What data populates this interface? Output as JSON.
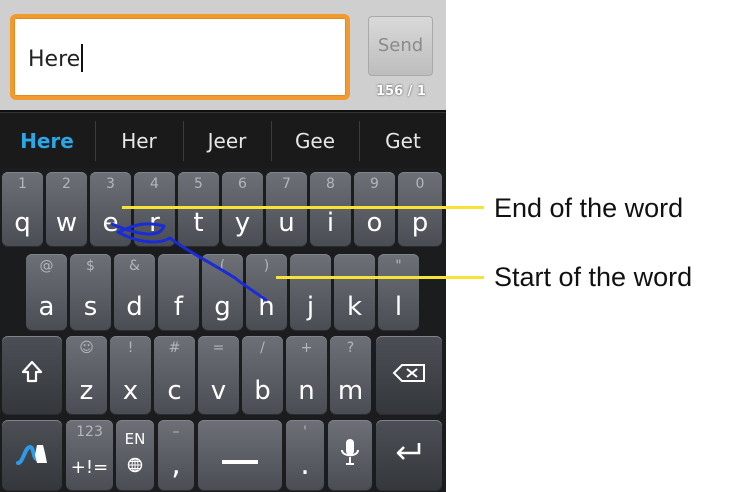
{
  "compose": {
    "message_value": "Here",
    "send_label": "Send",
    "counter": "156 / 1",
    "accent_color": "#f29a2e"
  },
  "suggestions": [
    "Here",
    "Her",
    "Jeer",
    "Gee",
    "Get"
  ],
  "suggestion_active_color": "#2ba6e6",
  "keyboard": {
    "row1": [
      {
        "hint": "1",
        "key": "q"
      },
      {
        "hint": "2",
        "key": "w"
      },
      {
        "hint": "3",
        "key": "e"
      },
      {
        "hint": "4",
        "key": "r"
      },
      {
        "hint": "5",
        "key": "t"
      },
      {
        "hint": "6",
        "key": "y"
      },
      {
        "hint": "7",
        "key": "u"
      },
      {
        "hint": "8",
        "key": "i"
      },
      {
        "hint": "9",
        "key": "o"
      },
      {
        "hint": "0",
        "key": "p"
      }
    ],
    "row2": [
      {
        "hint": "@",
        "key": "a"
      },
      {
        "hint": "$",
        "key": "s"
      },
      {
        "hint": "&",
        "key": "d"
      },
      {
        "hint": "",
        "key": "f"
      },
      {
        "hint": "(",
        "key": "g"
      },
      {
        "hint": ")",
        "key": "h"
      },
      {
        "hint": "",
        "key": "j"
      },
      {
        "hint": "",
        "key": "k"
      },
      {
        "hint": "\"",
        "key": "l"
      }
    ],
    "row3": [
      {
        "hint": "☺",
        "key": "z"
      },
      {
        "hint": "!",
        "key": "x"
      },
      {
        "hint": "#",
        "key": "c"
      },
      {
        "hint": "=",
        "key": "v"
      },
      {
        "hint": "/",
        "key": "b"
      },
      {
        "hint": "+",
        "key": "n"
      },
      {
        "hint": "?",
        "key": "m"
      }
    ],
    "row4": {
      "symbols_hint": "123",
      "symbols_label": "+!=",
      "lang_label": "EN",
      "comma_hint": "–",
      "comma_key": ",",
      "period_hint": "'",
      "period_key": "."
    },
    "icons": {
      "shift": "shift-icon",
      "delete": "backspace-icon",
      "swype": "swype-logo-icon",
      "globe": "globe-icon",
      "space": "space-bar-icon",
      "mic": "microphone-icon",
      "enter": "enter-icon"
    }
  },
  "annotations": {
    "end_of_word": "End of the word",
    "start_of_word": "Start of the word",
    "line_color": "#f6e336",
    "trace_color": "#1a2bd8"
  }
}
